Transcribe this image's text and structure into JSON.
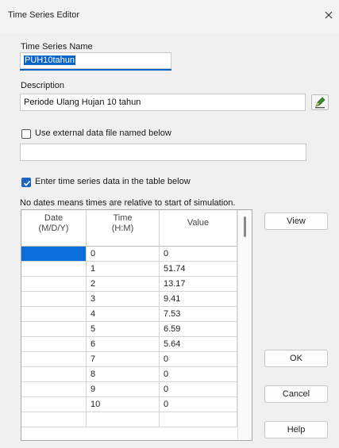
{
  "window": {
    "title": "Time Series Editor"
  },
  "name": {
    "label": "Time Series Name",
    "value": "PUH10tahun"
  },
  "description": {
    "label": "Description",
    "value": "Periode Ulang Hujan 10 tahun"
  },
  "external": {
    "label": "Use external data file named below",
    "checked": false,
    "value": ""
  },
  "enter_table": {
    "label": "Enter time series data in the table below",
    "checked": true
  },
  "note": "No dates means times are relative to start of simulation.",
  "table": {
    "headers": {
      "date_line1": "Date",
      "date_line2": "(M/D/Y)",
      "time_line1": "Time",
      "time_line2": "(H:M)",
      "value": "Value"
    },
    "rows": [
      {
        "date": "",
        "time": "0",
        "value": "0"
      },
      {
        "date": "",
        "time": "1",
        "value": "51.74"
      },
      {
        "date": "",
        "time": "2",
        "value": "13.17"
      },
      {
        "date": "",
        "time": "3",
        "value": "9.41"
      },
      {
        "date": "",
        "time": "4",
        "value": "7.53"
      },
      {
        "date": "",
        "time": "5",
        "value": "6.59"
      },
      {
        "date": "",
        "time": "6",
        "value": "5.64"
      },
      {
        "date": "",
        "time": "7",
        "value": "0"
      },
      {
        "date": "",
        "time": "8",
        "value": "0"
      },
      {
        "date": "",
        "time": "9",
        "value": "0"
      },
      {
        "date": "",
        "time": "10",
        "value": "0"
      },
      {
        "date": "",
        "time": "",
        "value": ""
      }
    ]
  },
  "buttons": {
    "view": "View",
    "ok": "OK",
    "cancel": "Cancel",
    "help": "Help"
  },
  "icons": {
    "close": "close-icon",
    "edit": "edit-pencil-icon",
    "check": "checkmark-icon"
  },
  "colors": {
    "accent": "#0a63c9",
    "checkbox": "#1d64c4"
  }
}
